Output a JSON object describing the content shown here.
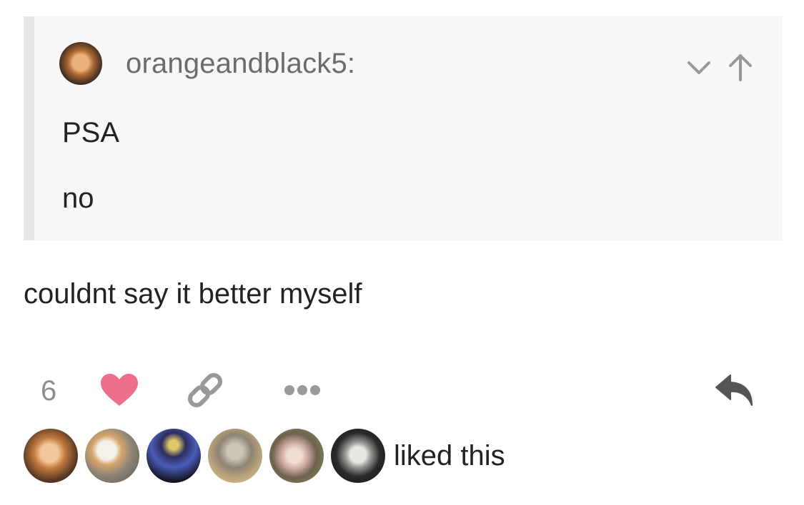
{
  "quote": {
    "username": "orangeandblack5:",
    "paragraphs": [
      "PSA",
      "no"
    ]
  },
  "comment": "couldnt say it better myself",
  "actions": {
    "note_count": "6"
  },
  "likers": {
    "suffix": "liked this"
  },
  "icons": {
    "collapse": "chevron-down-icon",
    "reblog_source": "arrow-up-icon",
    "like": "heart-icon",
    "link": "link-icon",
    "more": "more-icon",
    "reply": "reply-icon"
  },
  "colors": {
    "heart": "#ee6f8c",
    "icon_gray": "#999999",
    "reply_gray": "#555555"
  }
}
